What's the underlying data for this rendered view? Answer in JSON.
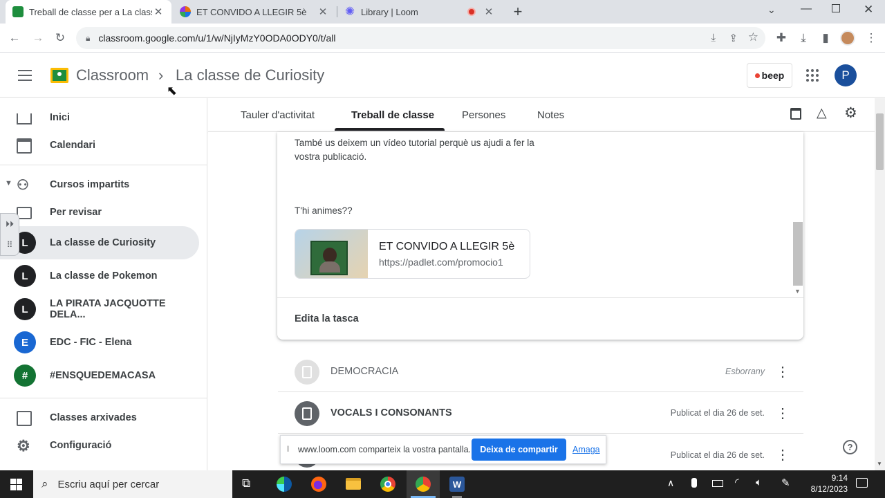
{
  "browser": {
    "tabs": [
      {
        "title": "Treball de classe per a La classe de Curiosity",
        "active": true
      },
      {
        "title": "ET CONVIDO A LLEGIR 5è",
        "active": false
      },
      {
        "title": "Library | Loom",
        "active": false
      }
    ],
    "url": "classroom.google.com/u/1/w/NjIyMzY0ODA0ODY0/t/all"
  },
  "header": {
    "app_name": "Classroom",
    "breadcrumb_sep": "›",
    "course_name": "La classe de Curiosity",
    "beep_label": "beep",
    "avatar_letter": "P"
  },
  "sidebar": {
    "items": [
      {
        "label": "Inici",
        "icon": "home-icon"
      },
      {
        "label": "Calendari",
        "icon": "calendar-icon"
      },
      {
        "label": "Cursos impartits",
        "icon": "people-icon"
      },
      {
        "label": "Per revisar",
        "icon": "review-icon"
      },
      {
        "label": "La classe de Curiosity",
        "letter": "L",
        "color": "#202124"
      },
      {
        "label": "La classe de Pokemon",
        "letter": "L",
        "color": "#202124"
      },
      {
        "label": "LA PIRATA JACQUOTTE DELA...",
        "letter": "L",
        "color": "#202124"
      },
      {
        "label": "EDC - FIC - Elena",
        "letter": "E",
        "color": "#1967d2"
      },
      {
        "label": "#ENSQUEDEMACASA",
        "letter": "#",
        "color": "#137333"
      },
      {
        "label": "Classes arxivades",
        "icon": "archive-icon"
      },
      {
        "label": "Configuració",
        "icon": "gear-icon"
      }
    ]
  },
  "class_tabs": [
    {
      "label": "Tauler d'activitat"
    },
    {
      "label": "Treball de classe",
      "active": true
    },
    {
      "label": "Persones"
    },
    {
      "label": "Notes"
    }
  ],
  "assignment": {
    "body_line1": "També us deixem un vídeo tutorial perquè us ajudi a fer la",
    "body_line2": "vostra publicació.",
    "question": "T'hi animes??",
    "attachment_title": "ET CONVIDO A LLEGIR 5è",
    "attachment_url": "https://padlet.com/promocio1",
    "edit_label": "Edita la tasca"
  },
  "tasks": [
    {
      "title": "DEMOCRACIA",
      "status": "Esborrany"
    },
    {
      "title": "VOCALS I CONSONANTS",
      "status": "Publicat el dia 26 de set."
    },
    {
      "title": "",
      "status": "Publicat el dia 26 de set."
    }
  ],
  "share_bar": {
    "text": "www.loom.com comparteix la vostra pantalla.",
    "stop_label": "Deixa de compartir",
    "hide_label": "Amaga"
  },
  "taskbar": {
    "search_placeholder": "Escriu aquí per cercar",
    "time": "9:14",
    "date": "8/12/2023"
  },
  "colors": {
    "accent_blue": "#1967d2",
    "classroom_green": "#1e8e3e",
    "active_tab_underline": "#202124"
  }
}
